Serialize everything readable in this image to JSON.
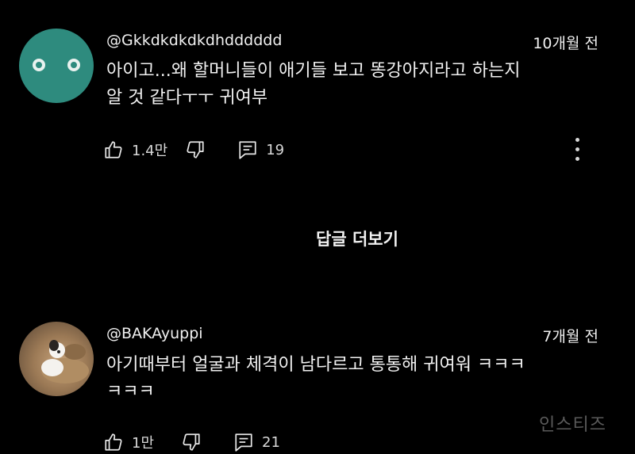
{
  "comments": [
    {
      "username": "@Gkkdkdkdkdhdddddd",
      "time": "10개월 전",
      "text_line1": "아이고...왜 할머니들이 애기들 보고 똥강아지라고 하는지",
      "text_line2": "알 것 같다ㅜㅜ 귀여부",
      "likes": "1.4만",
      "replies": "19",
      "avatar_icon": "two-eyes-avatar",
      "avatar_color": "#2e8b7e"
    },
    {
      "username": "@BAKAyuppi",
      "time": "7개월 전",
      "text_line1": "아기때부터 얼굴과 체격이 남다르고 통통해 귀여워 ㅋㅋㅋ",
      "text_line2": "ㅋㅋㅋ",
      "likes": "1만",
      "replies": "21",
      "avatar_icon": "photo-avatar"
    }
  ],
  "see_replies_label": "답글 더보기",
  "watermark": "인스티즈",
  "icons": {
    "like": "thumb-up-icon",
    "dislike": "thumb-down-icon",
    "reply": "comment-icon",
    "more": "more-vertical-icon"
  }
}
